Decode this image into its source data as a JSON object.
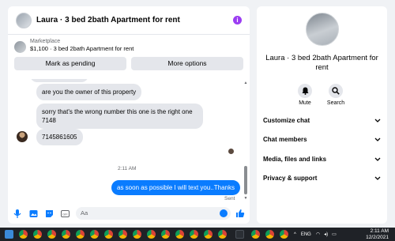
{
  "header": {
    "title": "Laura · 3 bed 2bath Apartment for rent",
    "info_icon": "i"
  },
  "marketplace": {
    "label": "Marketplace",
    "listing": "$1,100 · 3 bed 2bath Apartment for rent"
  },
  "buttons": {
    "mark_pending": "Mark as pending",
    "more_options": "More options"
  },
  "messages": {
    "m1": "are you the owner of this property",
    "m2": "sorry that's the wrong number this one is the right one 7148",
    "m3": "7145861605",
    "timestamp": "2:11 AM",
    "m4": "as soon as possible I will text you..Thanks",
    "status": "Sent"
  },
  "composer": {
    "placeholder": "Aa"
  },
  "info_panel": {
    "name": "Laura · 3 bed 2bath Apartment for rent",
    "actions": [
      {
        "label": "Mute",
        "icon": "bell-icon"
      },
      {
        "label": "Search",
        "icon": "search-icon"
      }
    ],
    "sections": [
      "Customize chat",
      "Chat members",
      "Media, files and links",
      "Privacy & support"
    ]
  },
  "taskbar": {
    "lang": "ENG",
    "time": "2:11 AM",
    "date": "12/2/2021"
  },
  "colors": {
    "accent": "#0a7cff",
    "bubble_in": "#e4e6eb",
    "info_purple": "#9b3df2",
    "taskbar": "#1f2227"
  }
}
